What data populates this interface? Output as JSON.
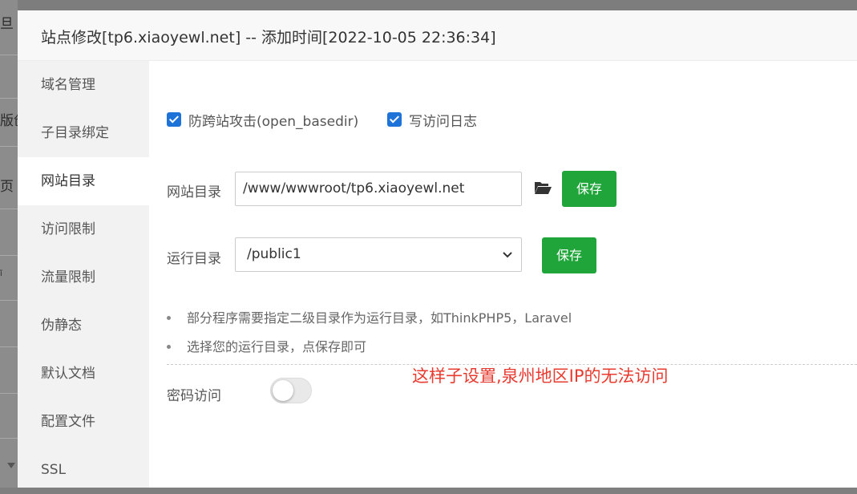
{
  "background_page": {
    "fragments": [
      "旦",
      "版创",
      "页",
      "ǐ"
    ]
  },
  "dialog": {
    "title": "站点修改[tp6.xiaoyewl.net] -- 添加时间[2022-10-05 22:36:34]"
  },
  "sidebar": {
    "items": [
      {
        "label": "域名管理"
      },
      {
        "label": "子目录绑定"
      },
      {
        "label": "网站目录",
        "active": true
      },
      {
        "label": "访问限制"
      },
      {
        "label": "流量限制"
      },
      {
        "label": "伪静态"
      },
      {
        "label": "默认文档"
      },
      {
        "label": "配置文件"
      },
      {
        "label": "SSL"
      }
    ]
  },
  "main": {
    "checkbox_anti_xss": {
      "label": "防跨站攻击(open_basedir)",
      "checked": true
    },
    "checkbox_access_log": {
      "label": "写访问日志",
      "checked": true
    },
    "site_dir": {
      "label": "网站目录",
      "value": "/www/wwwroot/tp6.xiaoyewl.net",
      "save_label": "保存"
    },
    "run_dir": {
      "label": "运行目录",
      "selected": "/public1",
      "save_label": "保存"
    },
    "tips": [
      "部分程序需要指定二级目录作为运行目录，如ThinkPHP5，Laravel",
      "选择您的运行目录，点保存即可"
    ],
    "password_access": {
      "label": "密码访问",
      "enabled": false
    },
    "annotation": "这样子设置,泉州地区IP的无法访问"
  },
  "colors": {
    "accent_green": "#20a53a",
    "checkbox_blue": "#1e73d8",
    "annotation_red": "#e83a2f"
  }
}
